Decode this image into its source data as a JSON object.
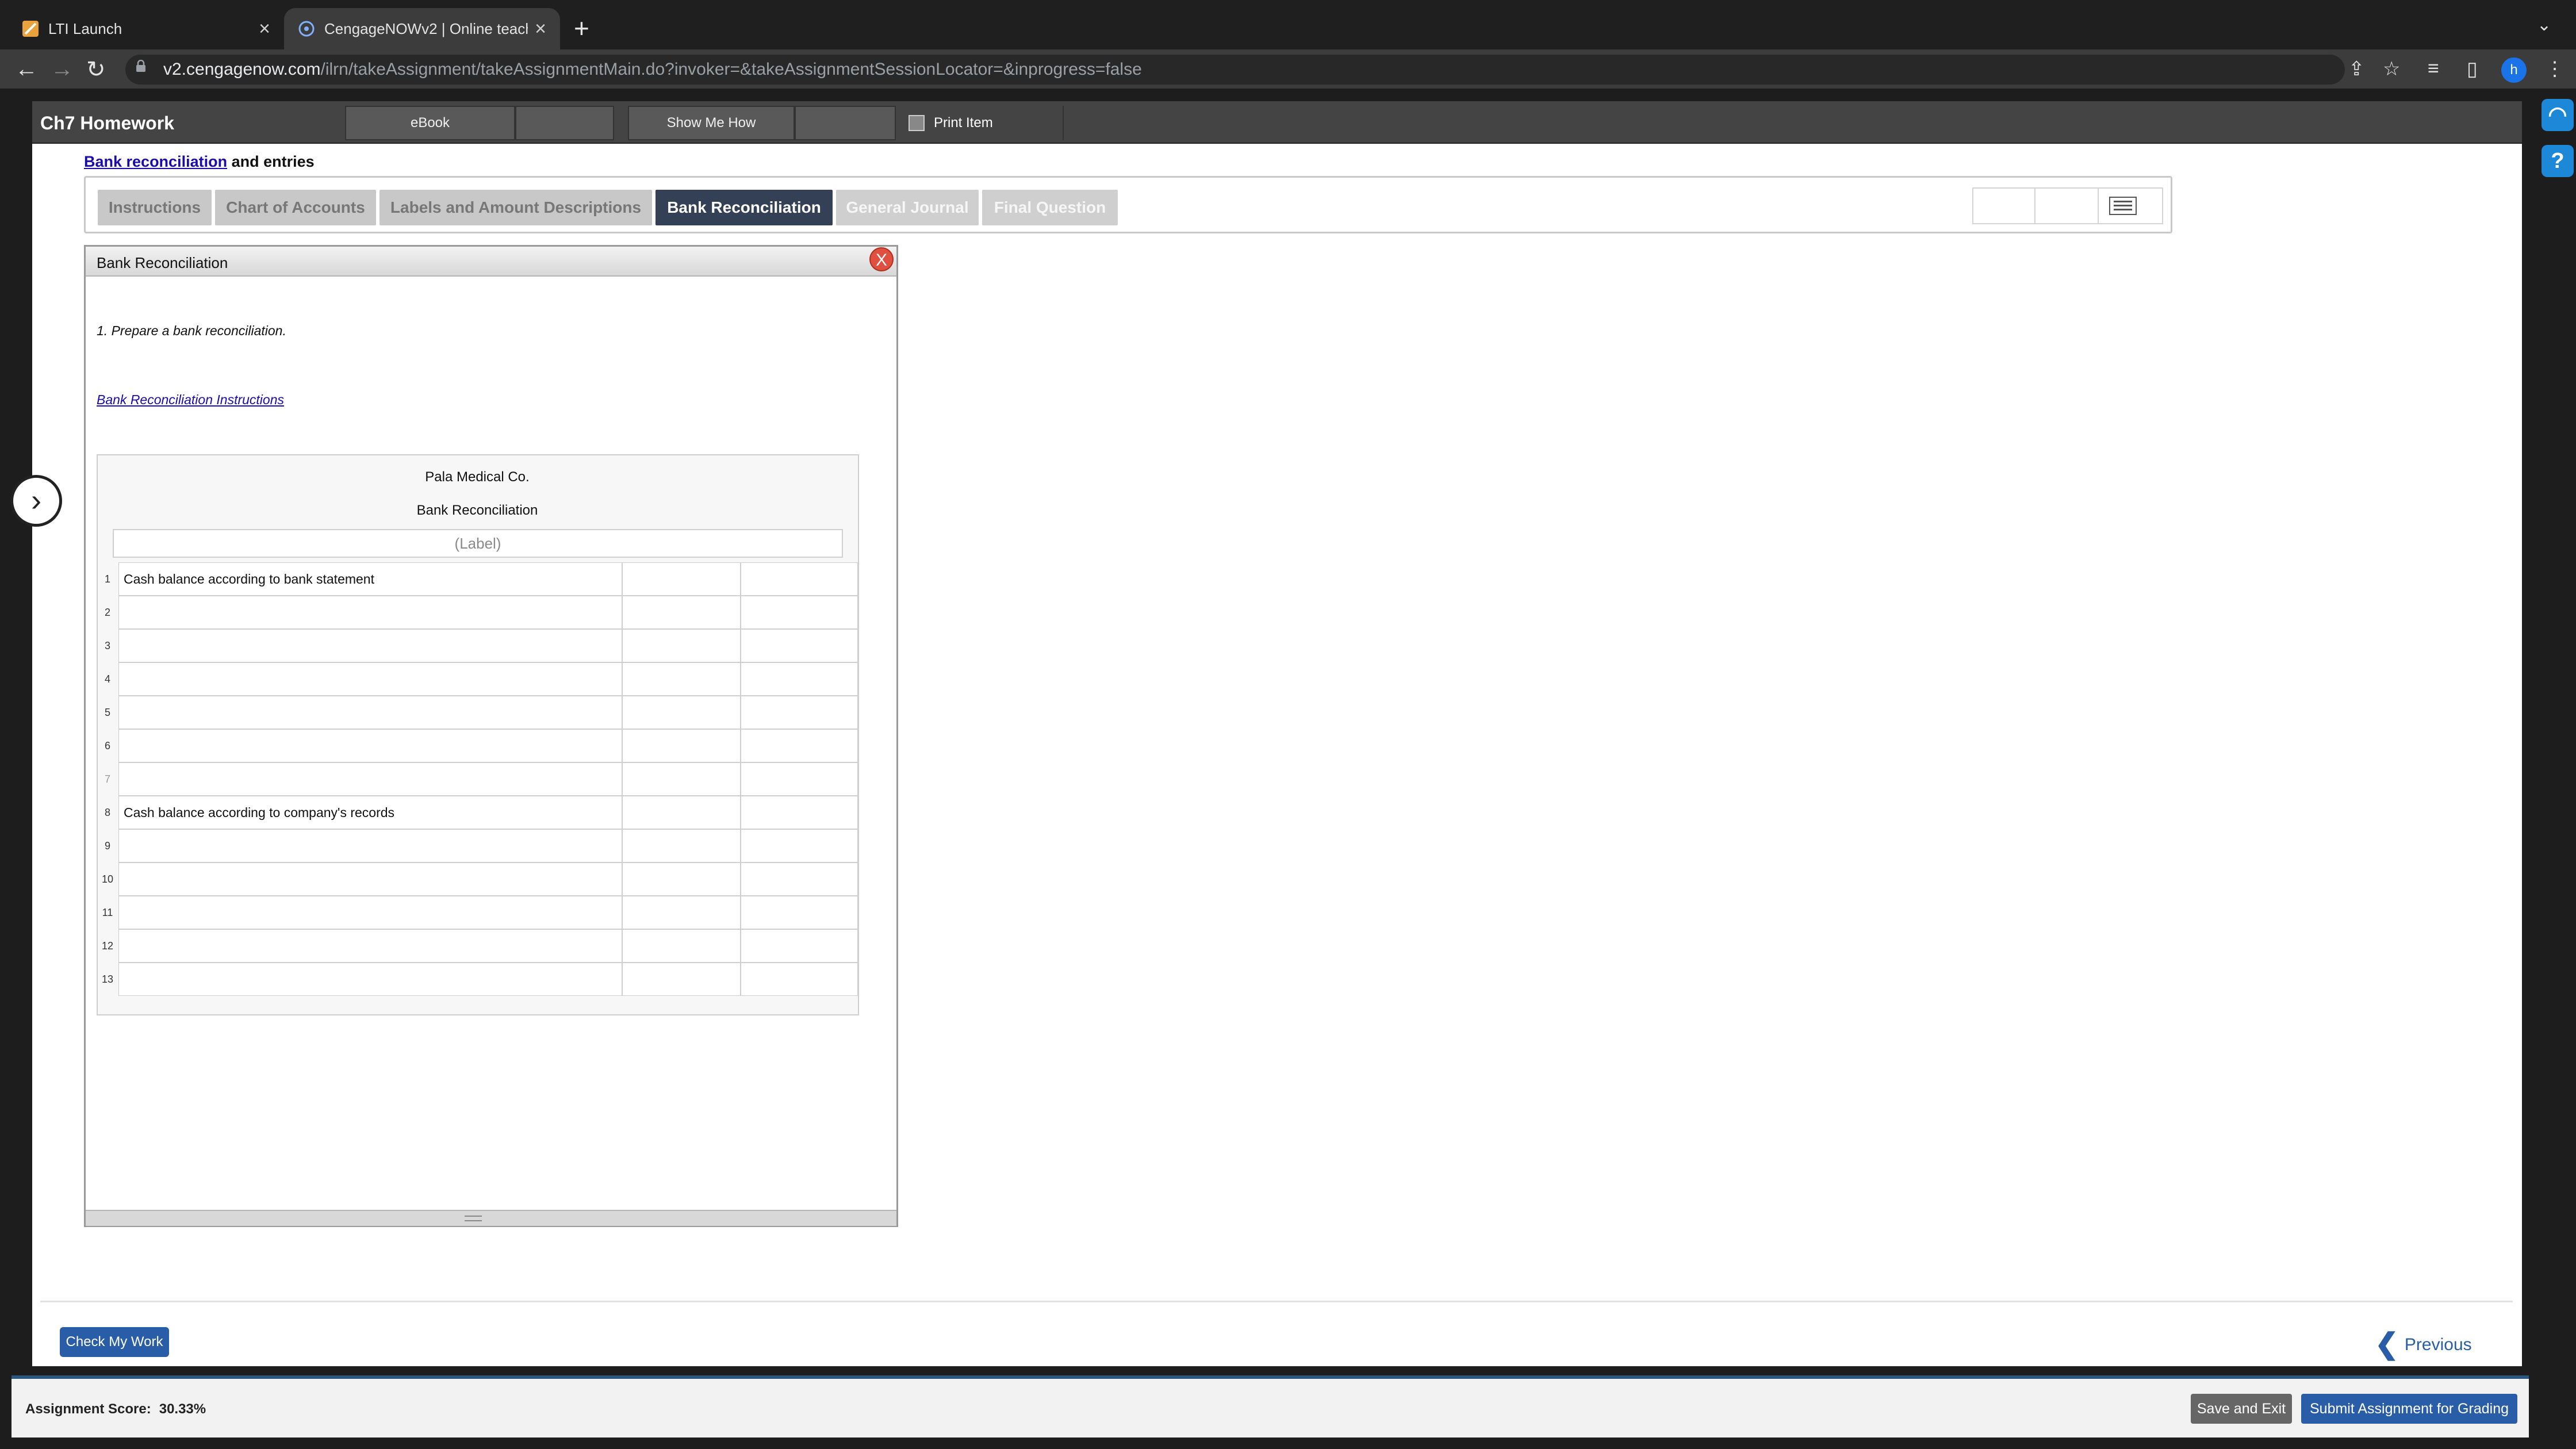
{
  "browser": {
    "tabs": [
      {
        "title": "LTI Launch",
        "active": false
      },
      {
        "title": "CengageNOWv2 | Online teach",
        "active": true
      }
    ],
    "url_host": "v2.cengagenow.com",
    "url_path": "/ilrn/takeAssignment/takeAssignmentMain.do?invoker=&takeAssignmentSessionLocator=&inprogress=false",
    "profile_initial": "h"
  },
  "app": {
    "title": "Ch7 Homework",
    "buttons": {
      "ebook": "eBook",
      "show_me_how": "Show Me How"
    },
    "print_item": "Print Item"
  },
  "content": {
    "heading_link": "Bank reconciliation",
    "heading_rest": " and entries",
    "tabs": [
      {
        "label": "Instructions",
        "state": "inactive"
      },
      {
        "label": "Chart of Accounts",
        "state": "inactive"
      },
      {
        "label": "Labels and Amount Descriptions",
        "state": "inactive"
      },
      {
        "label": "Bank Reconciliation",
        "state": "active"
      },
      {
        "label": "General Journal",
        "state": "disabled"
      },
      {
        "label": "Final Question",
        "state": "disabled"
      }
    ]
  },
  "panel": {
    "title": "Bank Reconciliation",
    "close_label": "X",
    "instruction": "1. Prepare a bank reconciliation.",
    "instructions_link": "Bank Reconciliation Instructions",
    "company": "Pala Medical Co.",
    "statement": "Bank Reconciliation",
    "label_placeholder": "(Label)",
    "rows": [
      {
        "num": "1",
        "desc": "Cash balance according to bank statement"
      },
      {
        "num": "2",
        "desc": ""
      },
      {
        "num": "3",
        "desc": ""
      },
      {
        "num": "4",
        "desc": ""
      },
      {
        "num": "5",
        "desc": ""
      },
      {
        "num": "6",
        "desc": ""
      },
      {
        "num": "7",
        "desc": ""
      },
      {
        "num": "8",
        "desc": "Cash balance according to company's records"
      },
      {
        "num": "9",
        "desc": ""
      },
      {
        "num": "10",
        "desc": ""
      },
      {
        "num": "11",
        "desc": ""
      },
      {
        "num": "12",
        "desc": ""
      },
      {
        "num": "13",
        "desc": ""
      }
    ]
  },
  "footer": {
    "check_my_work": "Check My Work",
    "previous": "Previous",
    "score_label": "Assignment Score:",
    "score_value": "30.33%",
    "save_exit": "Save and Exit",
    "submit": "Submit Assignment for Grading"
  },
  "colors": {
    "accent": "#2a5da8",
    "active_tab": "#334055"
  }
}
